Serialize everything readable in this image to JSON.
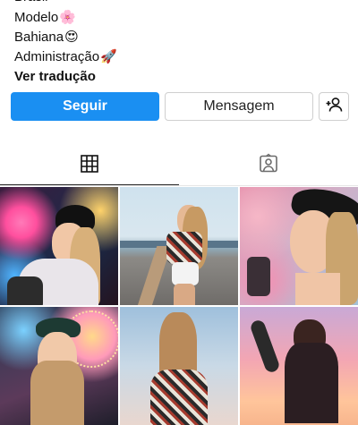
{
  "bio": {
    "partial_top": "Brasil",
    "lines": [
      {
        "text": "Modelo",
        "emoji": "🌸"
      },
      {
        "text": "Bahiana",
        "emoji": "😍"
      },
      {
        "text": "Administração",
        "emoji": "🚀"
      }
    ],
    "translate_link": "Ver tradução"
  },
  "actions": {
    "follow_label": "Seguir",
    "message_label": "Mensagem",
    "add_user_icon": "add-user-icon"
  },
  "tabs": [
    {
      "icon": "grid-icon",
      "active": true
    },
    {
      "icon": "tagged-icon",
      "active": false
    }
  ],
  "colors": {
    "accent": "#1a8ff2",
    "border": "#cfcfcf",
    "text": "#111111"
  },
  "posts": [
    {
      "id": "post-1",
      "subject": "woman in black cap at neon fairground"
    },
    {
      "id": "post-2",
      "subject": "woman in plaid top on beach road"
    },
    {
      "id": "post-3",
      "subject": "woman in black cap looking up"
    },
    {
      "id": "post-4",
      "subject": "woman in cap at ferris wheel"
    },
    {
      "id": "post-5",
      "subject": "woman portrait against sky"
    },
    {
      "id": "post-6",
      "subject": "woman at sunset sky"
    }
  ]
}
